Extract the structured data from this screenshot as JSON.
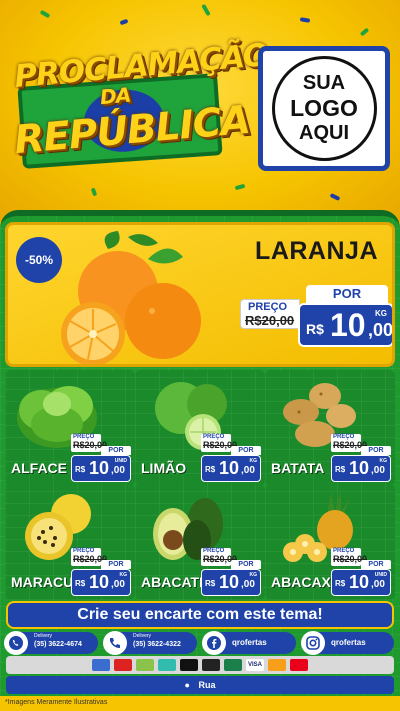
{
  "header": {
    "title_line1": "PROCLAMAÇÃO",
    "title_line2": "DA",
    "title_line3": "REPÚBLICA",
    "logo_line1": "SUA",
    "logo_line2": "LOGO",
    "logo_line3": "AQUI"
  },
  "hero": {
    "discount": "-50%",
    "name": "LARANJA",
    "preco_label": "PREÇO",
    "old_price": "R$20,00",
    "por_label": "POR",
    "currency": "R$",
    "price_int": "10",
    "price_dec": ",00",
    "unit": "KG"
  },
  "products": [
    {
      "name": "ALFACE",
      "preco_label": "PREÇO",
      "old_price": "R$20,00",
      "por_label": "POR",
      "currency": "R$",
      "price_int": "10",
      "price_dec": ",00",
      "unit": "UNID"
    },
    {
      "name": "LIMÃO",
      "preco_label": "PREÇO",
      "old_price": "R$20,00",
      "por_label": "POR",
      "currency": "R$",
      "price_int": "10",
      "price_dec": ",00",
      "unit": "KG"
    },
    {
      "name": "BATATA",
      "preco_label": "PREÇO",
      "old_price": "R$20,00",
      "por_label": "POR",
      "currency": "R$",
      "price_int": "10",
      "price_dec": ",00",
      "unit": "KG"
    },
    {
      "name": "MARACUJÁ",
      "preco_label": "PREÇO",
      "old_price": "R$20,00",
      "por_label": "POR",
      "currency": "R$",
      "price_int": "10",
      "price_dec": ",00",
      "unit": "KG"
    },
    {
      "name": "ABACATE",
      "preco_label": "PREÇO",
      "old_price": "R$20,00",
      "por_label": "POR",
      "currency": "R$",
      "price_int": "10",
      "price_dec": ",00",
      "unit": "KG"
    },
    {
      "name": "ABACAXI",
      "preco_label": "PREÇO",
      "old_price": "R$20,00",
      "por_label": "POR",
      "currency": "R$",
      "price_int": "10",
      "price_dec": ",00",
      "unit": "UNID"
    }
  ],
  "cta": "Crie seu encarte com este tema!",
  "contacts": {
    "whatsapp_sub": "Delivery",
    "whatsapp_phone": "(35) 3622-4674",
    "phone_sub": "Delivery",
    "phone_number": "(35) 3622-4322",
    "facebook": "qrofertas",
    "instagram": "qrofertas"
  },
  "payments": [
    "",
    "",
    "",
    "",
    "",
    "",
    "",
    "VISA",
    "",
    ""
  ],
  "address": "Rua",
  "footer_note": "*Imagens Meramente Ilustrativas",
  "colors": {
    "yellow": "#f6c400",
    "green": "#1f9a2f",
    "blue": "#1f43a8"
  }
}
